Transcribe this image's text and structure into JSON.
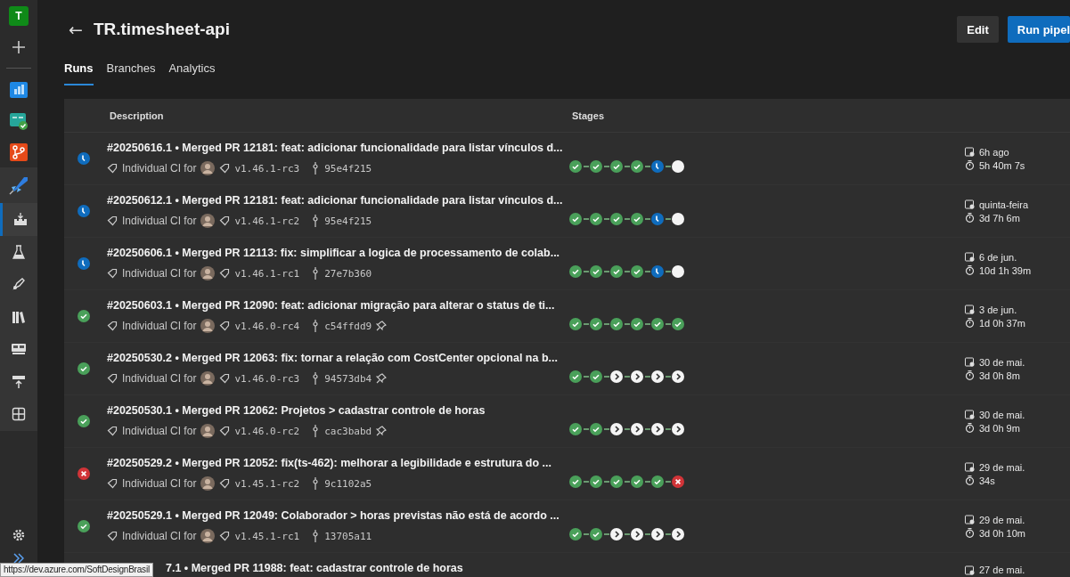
{
  "sidebar": {
    "avatar": "T",
    "items": [
      {
        "kind": "add",
        "selected": false
      },
      {
        "kind": "boards",
        "selected": false
      },
      {
        "kind": "testplans",
        "selected": false
      },
      {
        "kind": "repos",
        "selected": false
      },
      {
        "kind": "pipelines",
        "selected": false
      },
      {
        "kind": "builds",
        "selected": true
      },
      {
        "kind": "environments",
        "selected": false
      },
      {
        "kind": "releases",
        "selected": false
      },
      {
        "kind": "library",
        "selected": false
      },
      {
        "kind": "taskgroups",
        "selected": false
      },
      {
        "kind": "deployments",
        "selected": false
      },
      {
        "kind": "grid",
        "selected": false
      },
      {
        "kind": "settings",
        "selected": false
      },
      {
        "kind": "expand",
        "selected": false
      }
    ]
  },
  "header": {
    "back": "←",
    "title": "TR.timesheet-api",
    "buttons": [
      {
        "label": "Edit",
        "kind": "secondary"
      },
      {
        "label": "Run pipel",
        "kind": "primary"
      }
    ]
  },
  "tabs": [
    {
      "label": "Runs",
      "selected": true
    },
    {
      "label": "Branches",
      "selected": false
    },
    {
      "label": "Analytics",
      "selected": false
    }
  ],
  "table": {
    "columns": [
      "Description",
      "Stages"
    ],
    "rows": [
      {
        "status": {
          "kind": "running"
        },
        "title": "#20250616.1 • Merged PR 12181: feat: adicionar funcionalidade para listar vínculos d...",
        "trigger": "Individual CI for",
        "version": "v1.46.1-rc3",
        "commit": "95e4f215",
        "retained": false,
        "stages": [
          {
            "kind": "succeeded"
          },
          {
            "kind": "succeeded"
          },
          {
            "kind": "succeeded"
          },
          {
            "kind": "succeeded"
          },
          {
            "kind": "running"
          },
          {
            "kind": "pending"
          }
        ],
        "started": "6h ago",
        "duration": "5h 40m 7s"
      },
      {
        "status": {
          "kind": "running"
        },
        "title": "#20250612.1 • Merged PR 12181: feat: adicionar funcionalidade para listar vínculos d...",
        "trigger": "Individual CI for",
        "version": "v1.46.1-rc2",
        "commit": "95e4f215",
        "retained": false,
        "stages": [
          {
            "kind": "succeeded"
          },
          {
            "kind": "succeeded"
          },
          {
            "kind": "succeeded"
          },
          {
            "kind": "succeeded"
          },
          {
            "kind": "running"
          },
          {
            "kind": "pending"
          }
        ],
        "started": "quinta-feira",
        "duration": "3d 7h 6m"
      },
      {
        "status": {
          "kind": "running"
        },
        "title": "#20250606.1 • Merged PR 12113: fix: simplificar a logica de processamento de colab...",
        "trigger": "Individual CI for",
        "version": "v1.46.1-rc1",
        "commit": "27e7b360",
        "retained": false,
        "stages": [
          {
            "kind": "succeeded"
          },
          {
            "kind": "succeeded"
          },
          {
            "kind": "succeeded"
          },
          {
            "kind": "succeeded"
          },
          {
            "kind": "running"
          },
          {
            "kind": "pending"
          }
        ],
        "started": "6 de jun.",
        "duration": "10d 1h 39m"
      },
      {
        "status": {
          "kind": "succeeded"
        },
        "title": "#20250603.1 • Merged PR 12090: feat: adicionar migração para alterar o status de ti...",
        "trigger": "Individual CI for",
        "version": "v1.46.0-rc4",
        "commit": "c54ffdd9",
        "retained": true,
        "stages": [
          {
            "kind": "succeeded"
          },
          {
            "kind": "succeeded"
          },
          {
            "kind": "succeeded"
          },
          {
            "kind": "succeeded"
          },
          {
            "kind": "succeeded"
          },
          {
            "kind": "succeeded"
          }
        ],
        "started": "3 de jun.",
        "duration": "1d 0h 37m"
      },
      {
        "status": {
          "kind": "succeeded"
        },
        "title": "#20250530.2 • Merged PR 12063: fix: tornar a relação com CostCenter opcional na b...",
        "trigger": "Individual CI for",
        "version": "v1.46.0-rc3",
        "commit": "94573db4",
        "retained": true,
        "stages": [
          {
            "kind": "succeeded"
          },
          {
            "kind": "succeeded"
          },
          {
            "kind": "skipped"
          },
          {
            "kind": "skipped"
          },
          {
            "kind": "skipped"
          },
          {
            "kind": "skipped"
          }
        ],
        "started": "30 de mai.",
        "duration": "3d 0h 8m"
      },
      {
        "status": {
          "kind": "succeeded"
        },
        "title": "#20250530.1 • Merged PR 12062: Projetos > cadastrar controle de horas",
        "trigger": "Individual CI for",
        "version": "v1.46.0-rc2",
        "commit": "cac3babd",
        "retained": true,
        "stages": [
          {
            "kind": "succeeded"
          },
          {
            "kind": "succeeded"
          },
          {
            "kind": "skipped"
          },
          {
            "kind": "skipped"
          },
          {
            "kind": "skipped"
          },
          {
            "kind": "skipped"
          }
        ],
        "started": "30 de mai.",
        "duration": "3d 0h 9m"
      },
      {
        "status": {
          "kind": "failed"
        },
        "title": "#20250529.2 • Merged PR 12052: fix(ts-462): melhorar a legibilidade e estrutura do ...",
        "trigger": "Individual CI for",
        "version": "v1.45.1-rc2",
        "commit": "9c1102a5",
        "retained": false,
        "stages": [
          {
            "kind": "succeeded"
          },
          {
            "kind": "succeeded"
          },
          {
            "kind": "succeeded"
          },
          {
            "kind": "succeeded"
          },
          {
            "kind": "succeeded"
          },
          {
            "kind": "failed"
          }
        ],
        "started": "29 de mai.",
        "duration": "34s"
      },
      {
        "status": {
          "kind": "succeeded"
        },
        "title": "#20250529.1 • Merged PR 12049: Colaborador > horas previstas não está de acordo ...",
        "trigger": "Individual CI for",
        "version": "v1.45.1-rc1",
        "commit": "13705a11",
        "retained": false,
        "stages": [
          {
            "kind": "succeeded"
          },
          {
            "kind": "succeeded"
          },
          {
            "kind": "skipped"
          },
          {
            "kind": "skipped"
          },
          {
            "kind": "skipped"
          },
          {
            "kind": "skipped"
          }
        ],
        "started": "29 de mai.",
        "duration": "3d 0h 10m"
      },
      {
        "title": "7.1 • Merged PR 11988: feat: cadastrar controle de horas",
        "started": "27 de mai."
      }
    ]
  },
  "status_url": "https://dev.azure.com/SoftDesignBrasil"
}
